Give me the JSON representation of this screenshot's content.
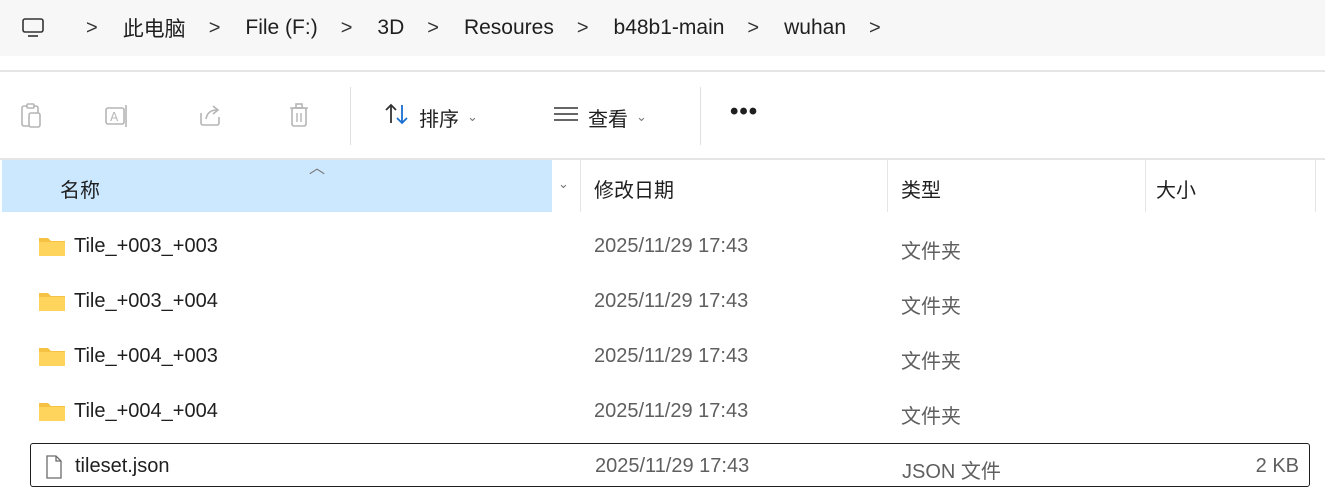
{
  "address_bar": {
    "icon": "computer-icon",
    "segments": [
      "此电脑",
      "File (F:)",
      "3D",
      "Resoures",
      "b48b1-main",
      "wuhan"
    ],
    "separator": ">"
  },
  "toolbar": {
    "sort_label": "排序",
    "view_label": "查看",
    "more_label": "•••",
    "icons": [
      "paste-icon",
      "rename-icon",
      "share-icon",
      "delete-icon",
      "sort-icon",
      "view-icon"
    ]
  },
  "columns": {
    "name": "名称",
    "modified": "修改日期",
    "type": "类型",
    "size": "大小"
  },
  "files": [
    {
      "name": "Tile_+003_+003",
      "modified": "2025/11/29 17:43",
      "type": "文件夹",
      "size": "",
      "icon": "folder-icon"
    },
    {
      "name": "Tile_+003_+004",
      "modified": "2025/11/29 17:43",
      "type": "文件夹",
      "size": "",
      "icon": "folder-icon"
    },
    {
      "name": "Tile_+004_+003",
      "modified": "2025/11/29 17:43",
      "type": "文件夹",
      "size": "",
      "icon": "folder-icon"
    },
    {
      "name": "Tile_+004_+004",
      "modified": "2025/11/29 17:43",
      "type": "文件夹",
      "size": "",
      "icon": "folder-icon"
    },
    {
      "name": "tileset.json",
      "modified": "2025/11/29 17:43",
      "type": "JSON 文件",
      "size": "2 KB",
      "icon": "file-icon",
      "selected": true
    }
  ],
  "colors": {
    "header_selected": "#cce8ff",
    "folder": "#f5c244"
  }
}
